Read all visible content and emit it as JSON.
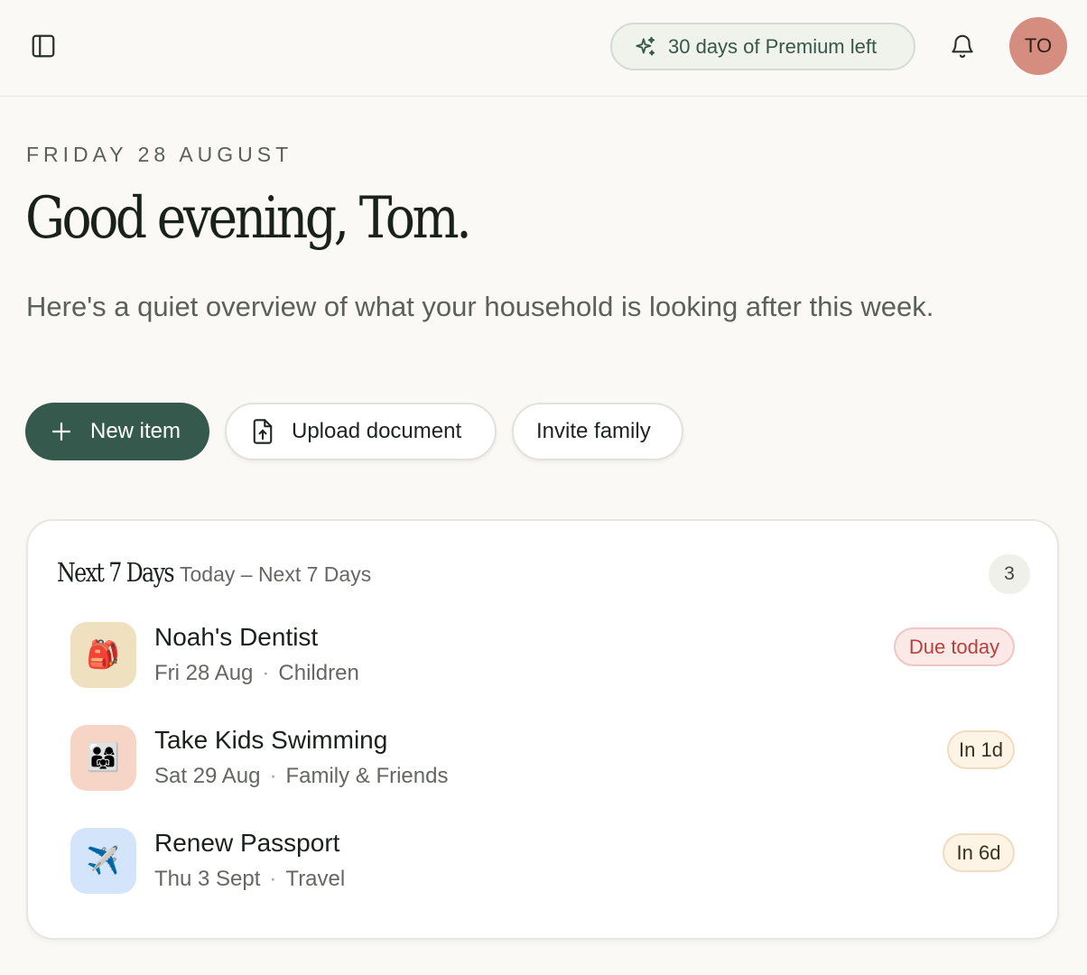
{
  "header": {
    "premium_label": "30 days of Premium left",
    "avatar_initials": "TO"
  },
  "hero": {
    "date": "FRIDAY 28 AUGUST",
    "greeting": "Good evening, Tom.",
    "subtitle": "Here's a quiet overview of what your household is looking after this week."
  },
  "actions": {
    "new_item": "New item",
    "upload_document": "Upload document",
    "invite_family": "Invite family"
  },
  "upcoming": {
    "title": "Next 7 Days",
    "subtitle": "Today – Next 7 Days",
    "count": "3",
    "items": [
      {
        "emoji": "🎒",
        "icon_name": "backpack-icon",
        "icon_bg": "#efe0bf",
        "title": "Noah's Dentist",
        "date": "Fri 28 Aug",
        "category": "Children",
        "badge": "Due today",
        "badge_style": "red"
      },
      {
        "emoji": "👨‍👩‍👧",
        "icon_name": "family-icon",
        "icon_bg": "#f7d5c6",
        "title": "Take Kids Swimming",
        "date": "Sat 29 Aug",
        "category": "Family & Friends",
        "badge": "In 1d",
        "badge_style": "amber"
      },
      {
        "emoji": "✈️",
        "icon_name": "airplane-icon",
        "icon_bg": "#d3e4fb",
        "title": "Renew Passport",
        "date": "Thu 3 Sept",
        "category": "Travel",
        "badge": "In 6d",
        "badge_style": "amber"
      }
    ]
  },
  "colors": {
    "background": "#faf9f5",
    "primary": "#35594d",
    "avatar": "#d48d7e",
    "due_today": "#b8403a"
  }
}
